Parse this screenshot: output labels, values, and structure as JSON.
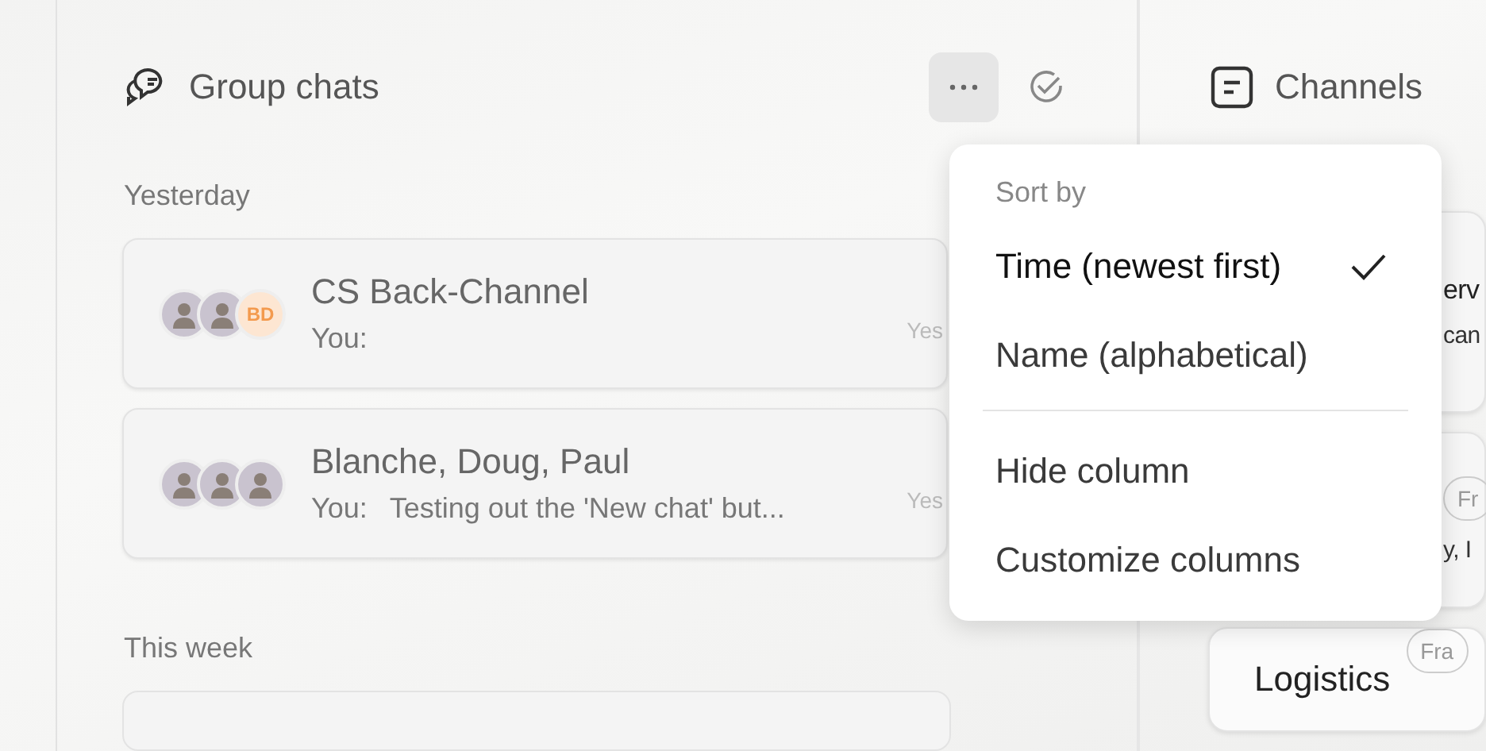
{
  "group_chats": {
    "title": "Group chats",
    "sections": [
      {
        "label": "Yesterday",
        "chats": [
          {
            "name": "CS Back-Channel",
            "sender": "You:",
            "time": "Yes",
            "avatars": [
              {
                "kind": "photo"
              },
              {
                "kind": "photo"
              },
              {
                "kind": "initials",
                "initials": "BD"
              }
            ]
          },
          {
            "name": "Blanche, Doug, Paul",
            "sender": "You:",
            "preview": "Testing out the 'New chat' but...",
            "time": "Yes",
            "avatars": [
              {
                "kind": "photo"
              },
              {
                "kind": "photo"
              },
              {
                "kind": "photo"
              }
            ]
          }
        ]
      },
      {
        "label": "This week"
      }
    ]
  },
  "channels": {
    "title": "Channels",
    "cards": [
      {
        "title": "erv",
        "preview": "can"
      },
      {
        "tag": "Fr",
        "preview": "y, I"
      },
      {
        "title": "Logistics",
        "tag": "Fra"
      }
    ]
  },
  "menu": {
    "open": true,
    "header": "Sort by",
    "sort_options": [
      {
        "label": "Time (newest first)",
        "selected": true
      },
      {
        "label": "Name (alphabetical)",
        "selected": false
      }
    ],
    "actions": [
      "Hide column",
      "Customize columns"
    ]
  }
}
